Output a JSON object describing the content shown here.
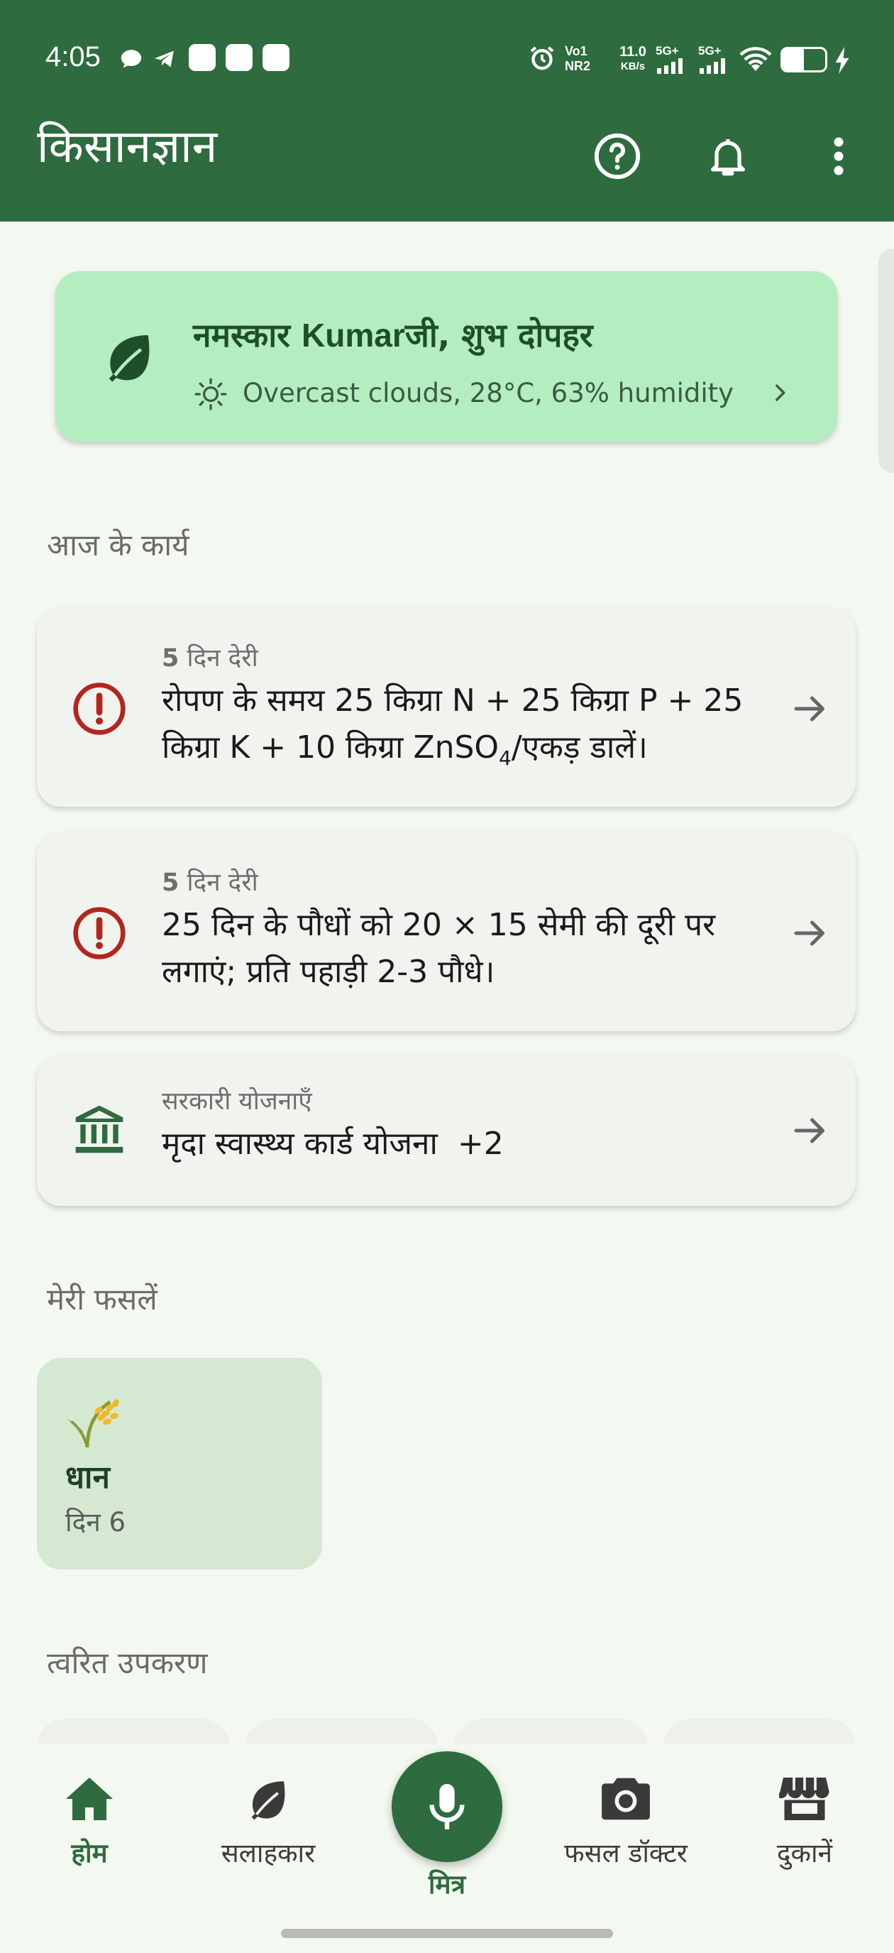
{
  "status_bar": {
    "time": "4:05",
    "network_1": "Vo1",
    "network_2": "NR2",
    "speed_value": "11.0",
    "speed_unit": "KB/s",
    "signal_1": "5G+",
    "signal_2": "5G+"
  },
  "app_bar": {
    "title": "किसानज्ञान",
    "icons": [
      "help-icon",
      "bell-icon",
      "more-vert-icon"
    ]
  },
  "greeting": {
    "prefix": "नमस्कार ",
    "name": "Kumar",
    "suffix": "जी, शुभ दोपहर",
    "weather": "Overcast clouds, 28°C, 63% humidity"
  },
  "tasks_section": {
    "title": "आज के कार्य"
  },
  "tasks": [
    {
      "delay_number": "5",
      "delay_text": " दिन देरी",
      "text_before": "रोपण के समय 25 किग्रा N + 25 किग्रा P + 25 किग्रा K + 10 किग्रा ZnSO",
      "subscript": "4",
      "text_after": "/एकड़ डालें।",
      "icon": "alert-icon"
    },
    {
      "delay_number": "5",
      "delay_text": " दिन देरी",
      "text": "25 दिन के पौधों को 20 × 15 सेमी की दूरी पर लगाएं; प्रति पहाड़ी 2-3 पौधे।",
      "icon": "alert-icon"
    }
  ],
  "schemes": {
    "label": "सरकारी योजनाएँ",
    "text": "मृदा स्वास्थ्य कार्ड योजना  +2",
    "icon": "bank-icon"
  },
  "crops_section": {
    "title": "मेरी फसलें"
  },
  "crops": [
    {
      "name": "धान",
      "day": "दिन 6",
      "icon": "rice-icon"
    }
  ],
  "tools_section": {
    "title": "त्वरित उपकरण"
  },
  "bottom_nav": {
    "items": [
      {
        "label": "होम",
        "icon": "home-icon",
        "active": true
      },
      {
        "label": "सलाहकार",
        "icon": "leaf-icon",
        "active": false
      },
      {
        "label": "मित्र",
        "icon": "mic-icon",
        "active": false
      },
      {
        "label": "फसल डॉक्टर",
        "icon": "camera-icon",
        "active": false
      },
      {
        "label": "दुकानें",
        "icon": "store-icon",
        "active": false
      }
    ]
  },
  "colors": {
    "primary": "#2e6b3e",
    "greeting_bg": "#b4eec0",
    "alert": "#b3261e",
    "background": "#f3f8f0"
  }
}
